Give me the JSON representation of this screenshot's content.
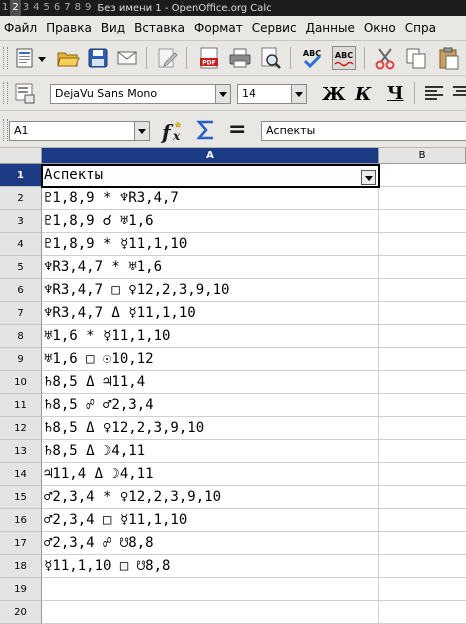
{
  "titlebar": {
    "workspaces": [
      "1",
      "2",
      "3",
      "4",
      "5",
      "6",
      "7",
      "8",
      "9"
    ],
    "active_workspace": "2",
    "title": "Без имени 1 - OpenOffice.org Calc"
  },
  "menu": [
    "Файл",
    "Правка",
    "Вид",
    "Вставка",
    "Формат",
    "Сервис",
    "Данные",
    "Окно",
    "Спра"
  ],
  "toolbar1": {
    "icons": [
      "new-document-icon",
      "open-folder-icon",
      "save-icon",
      "email-icon",
      "edit-file-icon",
      "export-pdf-icon",
      "print-icon",
      "page-preview-icon",
      "spellcheck-icon",
      "autospellcheck-icon",
      "cut-icon",
      "copy-icon"
    ],
    "spellcheck_label": "ABC"
  },
  "toolbar2": {
    "font_name": "DejaVu Sans Mono",
    "font_size": "14",
    "bold_label": "Ж",
    "italic_label": "К",
    "underline_label": "Ч"
  },
  "formula": {
    "cell_ref": "A1",
    "equals_label": "=",
    "content": "Аспекты"
  },
  "grid": {
    "selected_column": "A",
    "columns": [
      "A",
      "B"
    ],
    "rows": [
      {
        "num": "1",
        "a": "Аспекты"
      },
      {
        "num": "2",
        "a": "♇1,8,9 * ♆R3,4,7"
      },
      {
        "num": "3",
        "a": "♇1,8,9 ☌ ♅1,6"
      },
      {
        "num": "4",
        "a": "♇1,8,9 * ☿11,1,10"
      },
      {
        "num": "5",
        "a": "♆R3,4,7 * ♅1,6"
      },
      {
        "num": "6",
        "a": "♆R3,4,7 □ ♀12,2,3,9,10"
      },
      {
        "num": "7",
        "a": "♆R3,4,7 Δ ☿11,1,10"
      },
      {
        "num": "8",
        "a": "♅1,6 * ☿11,1,10"
      },
      {
        "num": "9",
        "a": "♅1,6 □ ☉10,12"
      },
      {
        "num": "10",
        "a": "♄8,5 Δ ♃11,4"
      },
      {
        "num": "11",
        "a": "♄8,5 ☍ ♂2,3,4"
      },
      {
        "num": "12",
        "a": "♄8,5 Δ ♀12,2,3,9,10"
      },
      {
        "num": "13",
        "a": "♄8,5 Δ ☽4,11"
      },
      {
        "num": "14",
        "a": "♃11,4 Δ ☽4,11"
      },
      {
        "num": "15",
        "a": "♂2,3,4 * ♀12,2,3,9,10"
      },
      {
        "num": "16",
        "a": "♂2,3,4 □ ☿11,1,10"
      },
      {
        "num": "17",
        "a": "♂2,3,4 ☍ ☋8,8"
      },
      {
        "num": "18",
        "a": "☿11,1,10 □ ☋8,8"
      },
      {
        "num": "19",
        "a": ""
      },
      {
        "num": "20",
        "a": ""
      }
    ]
  },
  "colors": {
    "selection_header": "#1b3c84",
    "toolbar_bg": "#e8e7e3"
  }
}
